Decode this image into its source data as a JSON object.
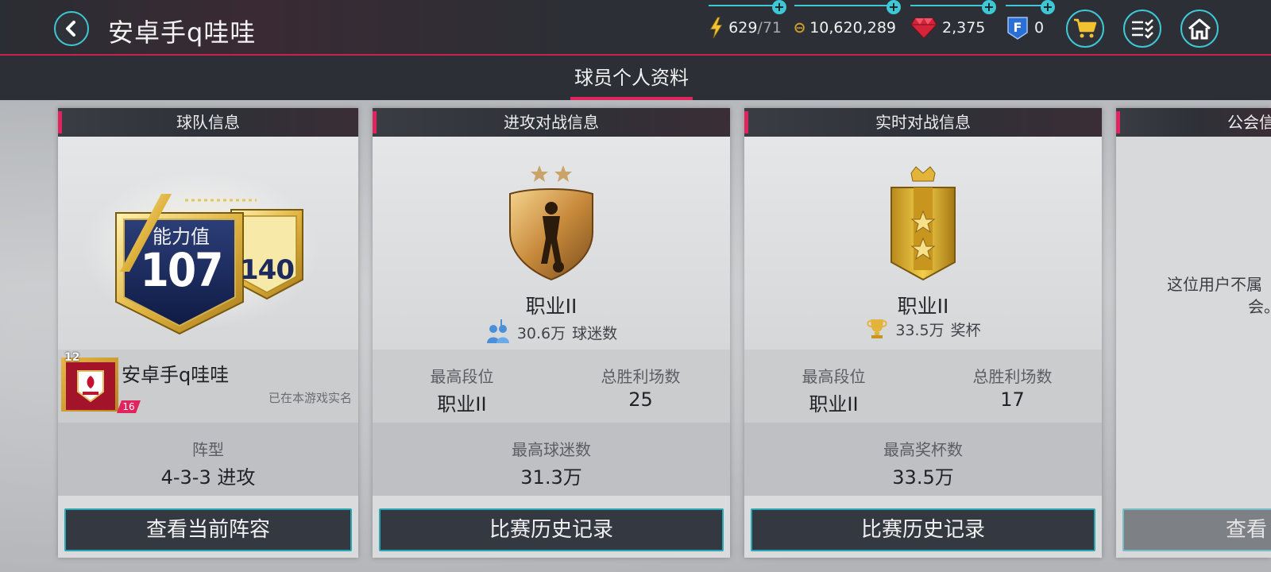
{
  "header": {
    "title": "安卓手q哇哇",
    "energy": {
      "current": "629",
      "max": "/71"
    },
    "coins": "10,620,289",
    "gems": "2,375",
    "fifa_points": "0"
  },
  "tabs": [
    {
      "label": "球员个人资料",
      "active": true
    }
  ],
  "team_card": {
    "header": "球队信息",
    "ovr_label": "能力值",
    "ovr_value": "107",
    "secondary_value": "140",
    "club_level": "12",
    "club_badge_level": "16",
    "club_name": "安卓手q哇哇",
    "verified": "已在本游戏实名",
    "formation_label": "阵型",
    "formation_value": "4-3-3 进攻",
    "button": "查看当前阵容"
  },
  "attack_card": {
    "header": "进攻对战信息",
    "rank": "职业II",
    "fans_value": "30.6万",
    "fans_label": "球迷数",
    "best_rank_label": "最高段位",
    "best_rank_value": "职业II",
    "wins_label": "总胜利场数",
    "wins_value": "25",
    "max_label": "最高球迷数",
    "max_value": "31.3万",
    "button": "比赛历史记录"
  },
  "live_card": {
    "header": "实时对战信息",
    "rank": "职业II",
    "trophy_value": "33.5万",
    "trophy_label": "奖杯",
    "best_rank_label": "最高段位",
    "best_rank_value": "职业II",
    "wins_label": "总胜利场数",
    "wins_value": "17",
    "max_label": "最高奖杯数",
    "max_value": "33.5万",
    "button": "比赛历史记录"
  },
  "league_card": {
    "header": "公会信",
    "message_line1": "这位用户不属",
    "message_line2": "会。",
    "button": "查看"
  },
  "colors": {
    "accent": "#3fc7d6",
    "highlight": "#e0245e",
    "topbar": "#2c2f35"
  }
}
